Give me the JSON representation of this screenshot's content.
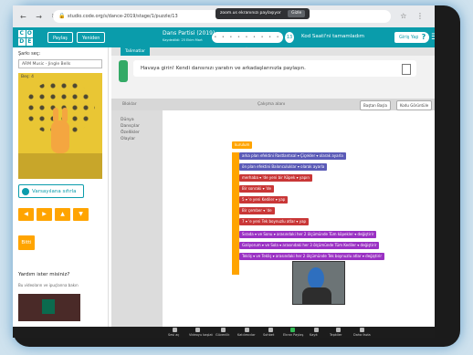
{
  "browser": {
    "nav_glyphs": "← → ↻",
    "url": "studio.code.org/s/dance-2019/stage/1/puzzle/13",
    "right_glyphs": "☆ ⋮",
    "share_banner": "zoom.us ekranınızı paylaşıyor",
    "share_stop": "Gizle"
  },
  "header": {
    "logo_letters": [
      "C",
      "O",
      "D",
      "E"
    ],
    "share_label": "Paylaş",
    "remix_label": "Yeniden",
    "project_title": "Dans Partisi (2019)",
    "project_subtitle": "Kaydedildi: 25 Ekim Mart",
    "level_dots": "• • • • • • • • • •",
    "level_number": "13",
    "teacher_note": "Kod Saati'ni tamamladım",
    "signin_label": "Giriş Yap",
    "help_label": "?",
    "menu_glyph": "☰"
  },
  "left_panel": {
    "song_label": "Şarkı seç:",
    "song_value": "ARM Music - Jingle Bells",
    "stage_label": "Beş: 4",
    "reset_button": "Varsayılana sıfırla",
    "arrow_buttons": [
      "◀",
      "▶",
      "▲",
      "▼"
    ],
    "run_button": "Bitti",
    "help_question": "Yardım ister misiniz?",
    "help_subtitle": "Bu videoların ve ipuçlarına bakın"
  },
  "instructions": {
    "tab_label": "Talimatlar",
    "text": "Havaya girin! Kendi dansınızı yaratın ve arkadaşlarınızla paylaşın."
  },
  "workspace": {
    "toolbox_title": "Bloklar",
    "workspace_title": "Çalışma alanı",
    "start_over": "Baştan Başla",
    "show_code": "Kodu Görüntüle",
    "categories": [
      "Dünya",
      "Dansçılar",
      "Özellikler",
      "Olaylar"
    ],
    "blocks": [
      {
        "text": "kurulum",
        "color": "hat"
      },
      {
        "text": "arka plan efektini  Rastlantısal ▾  Çiçekler ▾  olarak ayarla",
        "color": "bl"
      },
      {
        "text": "ön plan efektini  Balonculuklar ▾  olarak ayarla",
        "color": "bl"
      },
      {
        "text": "merhaba ▾  'de yeni bir  Köpek ▾  yapın",
        "color": "rd"
      },
      {
        "text": "Bir  sonraki ▾  'de",
        "color": "rd"
      },
      {
        "text": "5 ▾  'e yeni  Kediler ▾  yap",
        "color": "rd"
      },
      {
        "text": "Bir  çember ▾  'de",
        "color": "rd"
      },
      {
        "text": "7 ▾  'e yeni  Tek boynuzlu atlar ▾  yap",
        "color": "rd"
      },
      {
        "text": "Sırada ▾  ve  Sonu ▾  arasındaki her  2  ölçümünde  Tüm köpekler ▾  değiştirir",
        "color": "pu"
      },
      {
        "text": "Galiyorum ▾  ve  Sola ▾  arasındaki her  3  ölçümünde  Tüm Kediler ▾  değiştirir",
        "color": "pu"
      },
      {
        "text": "Tekliş ▾  ve  Tekliş ▾  arasındaki her  2  ölçümünde  Tek boynuzlu atlar ▾  değiştirir",
        "color": "pu"
      }
    ]
  },
  "taskbar": {
    "items": [
      "Sesi aç",
      "Videoyu başlat",
      "Güvenlik",
      "Katılımcılar",
      "Sohbet",
      "Ekran Paylaş",
      "Kayıt",
      "Tepkiler",
      "Daha fazla"
    ]
  }
}
